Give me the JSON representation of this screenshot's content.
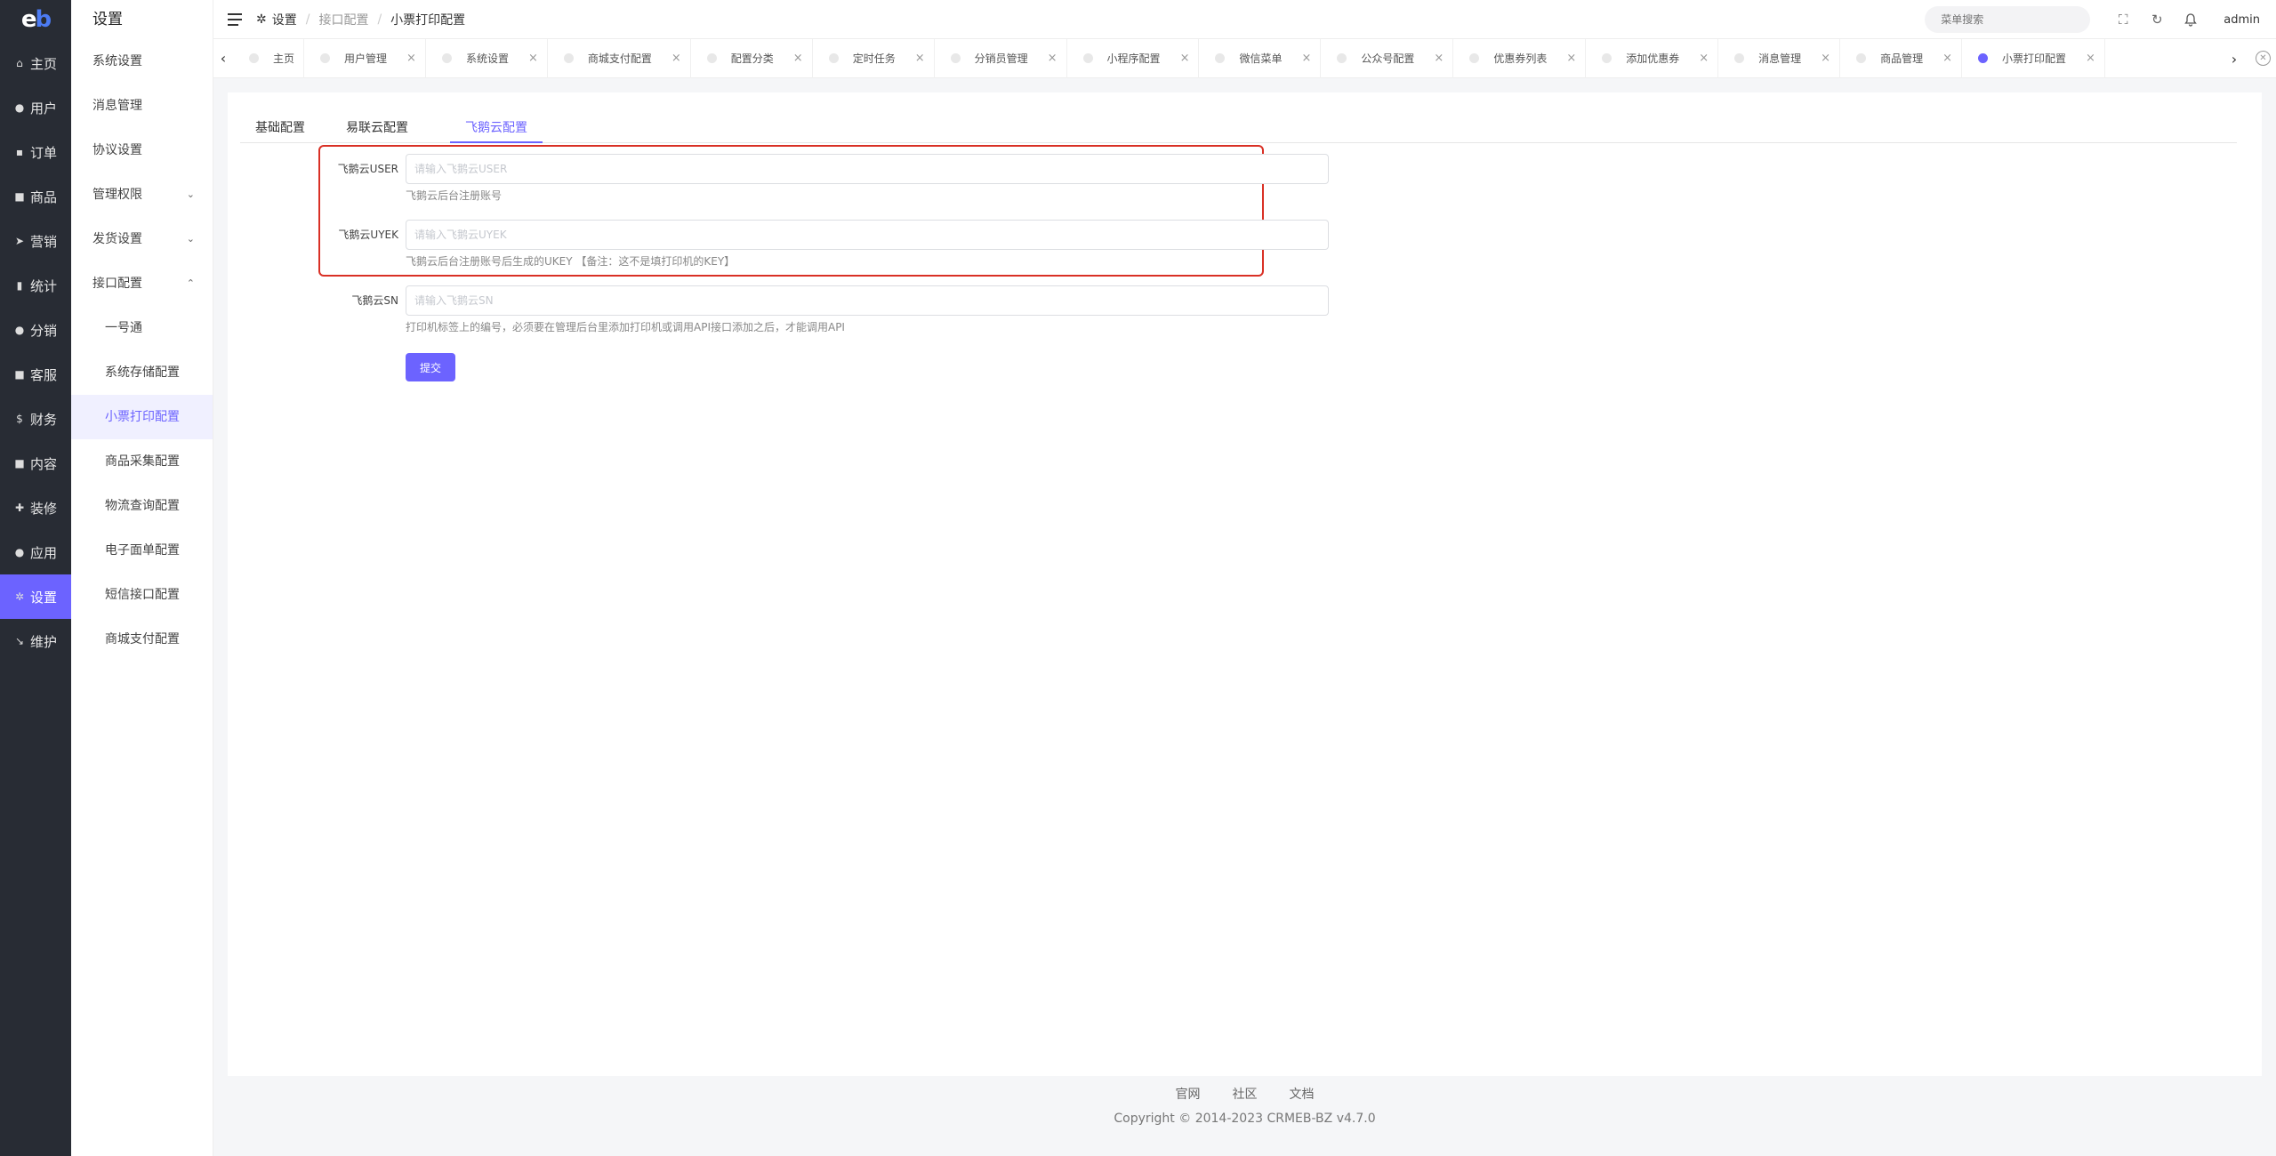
{
  "logo": {
    "e": "e",
    "b": "b"
  },
  "main_nav": [
    {
      "label": "主页",
      "icon": "home-icon",
      "glyph": "⌂"
    },
    {
      "label": "用户",
      "icon": "user-icon",
      "glyph": "●"
    },
    {
      "label": "订单",
      "icon": "cart-icon",
      "glyph": "▪"
    },
    {
      "label": "商品",
      "icon": "goods-icon",
      "glyph": "■"
    },
    {
      "label": "营销",
      "icon": "send-icon",
      "glyph": "➤"
    },
    {
      "label": "统计",
      "icon": "chart-icon",
      "glyph": "▮"
    },
    {
      "label": "分销",
      "icon": "share-icon",
      "glyph": "●"
    },
    {
      "label": "客服",
      "icon": "chat-icon",
      "glyph": "■"
    },
    {
      "label": "财务",
      "icon": "dollar-icon",
      "glyph": "$"
    },
    {
      "label": "内容",
      "icon": "book-icon",
      "glyph": "■"
    },
    {
      "label": "装修",
      "icon": "tools-icon",
      "glyph": "✚"
    },
    {
      "label": "应用",
      "icon": "app-icon",
      "glyph": "●"
    },
    {
      "label": "设置",
      "icon": "gear-icon",
      "glyph": "✲"
    },
    {
      "label": "维护",
      "icon": "hammer-icon",
      "glyph": "↘"
    }
  ],
  "sub_menu": {
    "title": "设置",
    "items": [
      {
        "label": "系统设置"
      },
      {
        "label": "消息管理"
      },
      {
        "label": "协议设置"
      },
      {
        "label": "管理权限",
        "arrow": "⌄"
      },
      {
        "label": "发货设置",
        "arrow": "⌄"
      },
      {
        "label": "接口配置",
        "arrow": "⌃"
      },
      {
        "label": "一号通"
      },
      {
        "label": "系统存储配置"
      },
      {
        "label": "小票打印配置"
      },
      {
        "label": "商品采集配置"
      },
      {
        "label": "物流查询配置"
      },
      {
        "label": "电子面单配置"
      },
      {
        "label": "短信接口配置"
      },
      {
        "label": "商城支付配置"
      }
    ]
  },
  "breadcrumb": {
    "root": "设置",
    "mid": "接口配置",
    "current": "小票打印配置",
    "sep": "/"
  },
  "header": {
    "search_placeholder": "菜单搜索",
    "user": "admin"
  },
  "tabs": [
    "主页",
    "用户管理",
    "系统设置",
    "商城支付配置",
    "配置分类",
    "定时任务",
    "分销员管理",
    "小程序配置",
    "微信菜单",
    "公众号配置",
    "优惠券列表",
    "添加优惠券",
    "消息管理",
    "商品管理",
    "小票打印配置"
  ],
  "tab_close_glyph": "×",
  "subtabs": [
    "基础配置",
    "易联云配置",
    "飞鹅云配置"
  ],
  "form": {
    "user": {
      "label": "飞鹅云USER",
      "placeholder": "请输入飞鹅云USER",
      "value": "",
      "tip": "飞鹅云后台注册账号"
    },
    "uyek": {
      "label": "飞鹅云UYEK",
      "placeholder": "请输入飞鹅云UYEK",
      "value": "",
      "tip": "飞鹅云后台注册账号后生成的UKEY 【备注：这不是填打印机的KEY】"
    },
    "sn": {
      "label": "飞鹅云SN",
      "placeholder": "请输入飞鹅云SN",
      "value": "",
      "tip": "打印机标签上的编号，必须要在管理后台里添加打印机或调用API接口添加之后，才能调用API"
    },
    "submit": "提交"
  },
  "footer": {
    "links": [
      "官网",
      "社区",
      "文档"
    ],
    "copyright": "Copyright © 2014-2023 CRMEB-BZ v4.7.0"
  },
  "colors": {
    "accent": "#6c63ff",
    "sidebar": "#282c34",
    "highlight_box": "#d93025"
  }
}
